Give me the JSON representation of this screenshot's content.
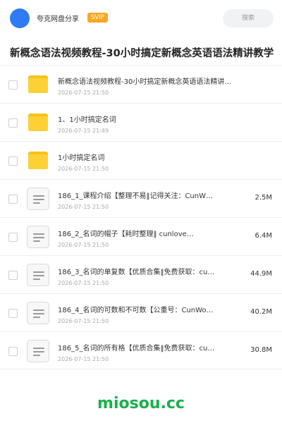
{
  "header": {
    "brand": "夸克网盘分享",
    "badge": "SVIP",
    "search_placeholder": "搜索"
  },
  "page_title": "新概念语法视频教程-30小时搞定新概念英语语法精讲教学",
  "files": [
    {
      "type": "folder",
      "name": "新概念语法视频教程-30小时搞定新概念英语语法精讲…",
      "date": "2026-07-15 21:50",
      "size": ""
    },
    {
      "type": "folder",
      "name": "1、1小时搞定名词",
      "date": "2026-07-15 21:49",
      "size": ""
    },
    {
      "type": "folder",
      "name": "1小时搞定名词",
      "date": "2026-07-15 21:50",
      "size": ""
    },
    {
      "type": "file",
      "name": "186_1_课程介绍【整理不易‖记得关注：CunW…",
      "date": "2026-07-15 21:50",
      "size": "2.5M"
    },
    {
      "type": "file",
      "name": "186_2_名词的帽子【耗时整理‖ cunlove…",
      "date": "2026-07-15 21:50",
      "size": "6.4M"
    },
    {
      "type": "file",
      "name": "186_3_名词的单复数【优质合集‖免费获取：cu…",
      "date": "2026-07-15 21:50",
      "size": "44.9M"
    },
    {
      "type": "file",
      "name": "186_4_名词的可数和不可数【公重号：CunWo…",
      "date": "2026-07-15 21:50",
      "size": "40.2M"
    },
    {
      "type": "file",
      "name": "186_5_名词的所有格【优质合集‖免费获取：cu…",
      "date": "2026-07-15 21:50",
      "size": "30.8M"
    }
  ],
  "watermark": "miosou.cc",
  "colors": {
    "accent": "#2f7bf5",
    "folder": "#fdd135",
    "badge": "#f9a825",
    "watermark": "#19b04b"
  }
}
